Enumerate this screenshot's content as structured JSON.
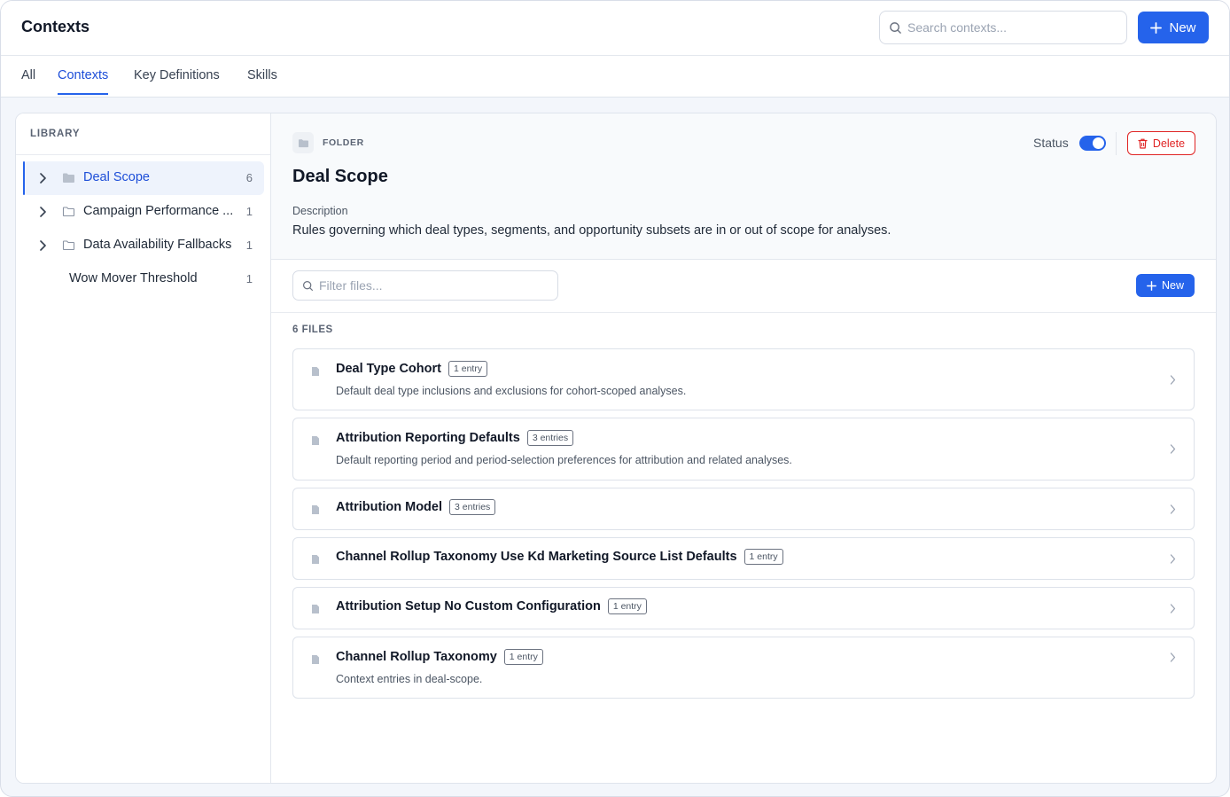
{
  "header": {
    "title": "Contexts",
    "search_placeholder": "Search contexts...",
    "new_label": "New"
  },
  "tabs": [
    {
      "label": "All",
      "active": false
    },
    {
      "label": "Contexts",
      "active": true
    },
    {
      "label": "Key Definitions",
      "active": false
    },
    {
      "label": "Skills",
      "active": false
    }
  ],
  "sidebar": {
    "heading": "LIBRARY",
    "items": [
      {
        "label": "Deal Scope",
        "count": "6",
        "folder": true,
        "active": true
      },
      {
        "label": "Campaign Performance ...",
        "count": "1",
        "folder": true,
        "active": false
      },
      {
        "label": "Data Availability Fallbacks",
        "count": "1",
        "folder": true,
        "active": false
      },
      {
        "label": "Wow Mover Threshold",
        "count": "1",
        "folder": false,
        "active": false
      }
    ]
  },
  "detail": {
    "kind": "FOLDER",
    "title": "Deal Scope",
    "description_label": "Description",
    "description": "Rules governing which deal types, segments, and opportunity subsets are in or out of scope for analyses.",
    "status_label": "Status",
    "status_on": true,
    "delete_label": "Delete",
    "filter_placeholder": "Filter files...",
    "new_label": "New",
    "files_count": "6 FILES",
    "files": [
      {
        "title": "Deal Type Cohort",
        "badge": "1 entry",
        "desc": "Default deal type inclusions and exclusions for cohort-scoped analyses."
      },
      {
        "title": "Attribution Reporting Defaults",
        "badge": "3 entries",
        "desc": "Default reporting period and period-selection preferences for attribution and related analyses."
      },
      {
        "title": "Attribution Model",
        "badge": "3 entries",
        "desc": ""
      },
      {
        "title": "Channel Rollup Taxonomy Use Kd Marketing Source List Defaults",
        "badge": "1 entry",
        "desc": ""
      },
      {
        "title": "Attribution Setup No Custom Configuration",
        "badge": "1 entry",
        "desc": ""
      },
      {
        "title": "Channel Rollup Taxonomy",
        "badge": "1 entry",
        "desc": "Context entries in deal-scope."
      }
    ]
  },
  "colors": {
    "accent": "#2563eb",
    "danger": "#e02424",
    "active_bg": "#eef3fc"
  }
}
